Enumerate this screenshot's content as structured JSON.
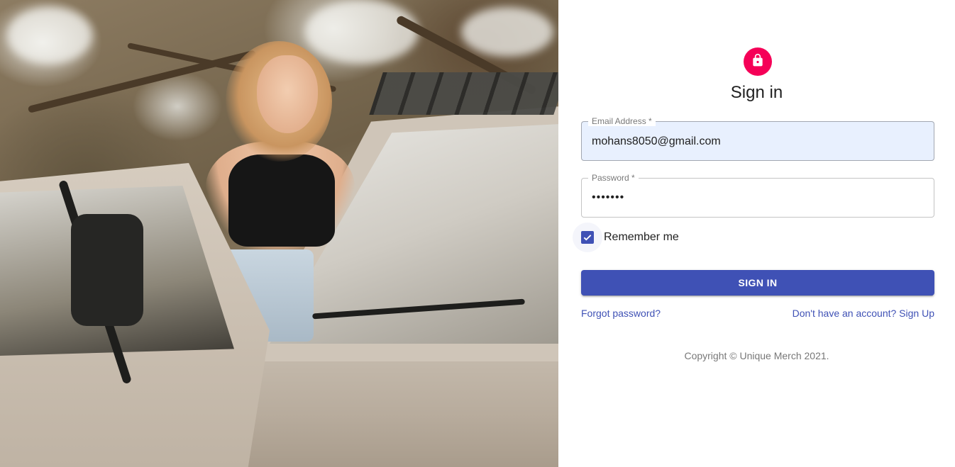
{
  "hero": {
    "image_icon": "photo-of-woman-on-vintage-van"
  },
  "signin": {
    "avatar_icon": "lock-icon",
    "avatar_color": "#f50057",
    "title": "Sign in",
    "email": {
      "label": "Email Address *",
      "value": "mohans8050@gmail.com"
    },
    "password": {
      "label": "Password *",
      "value": "•••••••"
    },
    "remember": {
      "label": "Remember me",
      "checked": true
    },
    "submit_label": "SIGN IN",
    "forgot_link": "Forgot password?",
    "signup_link": "Don't have an account? Sign Up",
    "copyright": "Copyright © Unique Merch 2021.",
    "primary_color": "#3f51b5"
  }
}
